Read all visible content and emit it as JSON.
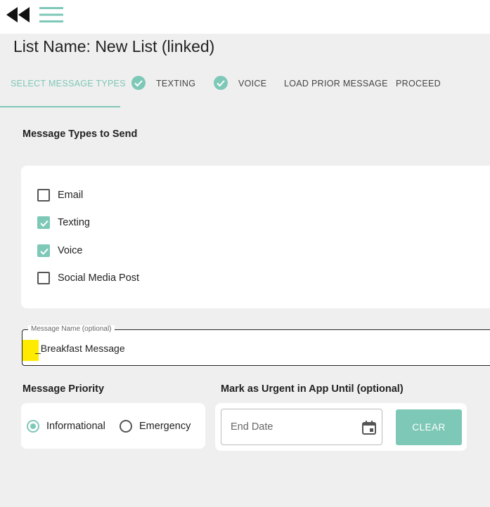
{
  "header": {
    "back_icon": "double-chevron-left-icon",
    "menu_icon": "hamburger-menu-icon",
    "list_name": "List Name: New List (linked)"
  },
  "steps": [
    {
      "label": "SELECT MESSAGE TYPES",
      "active": true,
      "checked": false
    },
    {
      "label": "TEXTING",
      "active": false,
      "checked": true
    },
    {
      "label": "VOICE",
      "active": false,
      "checked": true
    },
    {
      "label": "LOAD PRIOR MESSAGE",
      "active": false,
      "checked": false
    },
    {
      "label": "PROCEED",
      "active": false,
      "checked": false
    }
  ],
  "message_types": {
    "title": "Message Types to Send",
    "options": [
      {
        "label": "Email",
        "checked": false
      },
      {
        "label": "Texting",
        "checked": true
      },
      {
        "label": "Voice",
        "checked": true
      },
      {
        "label": "Social Media Post",
        "checked": false
      }
    ]
  },
  "message_name": {
    "label": "Message Name (optional)",
    "value": "_Breakfast Message"
  },
  "priority": {
    "title": "Message Priority",
    "options": [
      {
        "label": "Informational",
        "selected": true
      },
      {
        "label": "Emergency",
        "selected": false
      }
    ]
  },
  "urgent": {
    "title": "Mark as Urgent in App Until (optional)",
    "placeholder": "End Date",
    "calendar_icon": "calendar-icon",
    "clear_label": "CLEAR"
  },
  "colors": {
    "accent": "#7ec8b8",
    "background": "#efefef",
    "highlight": "#ffeb00"
  }
}
